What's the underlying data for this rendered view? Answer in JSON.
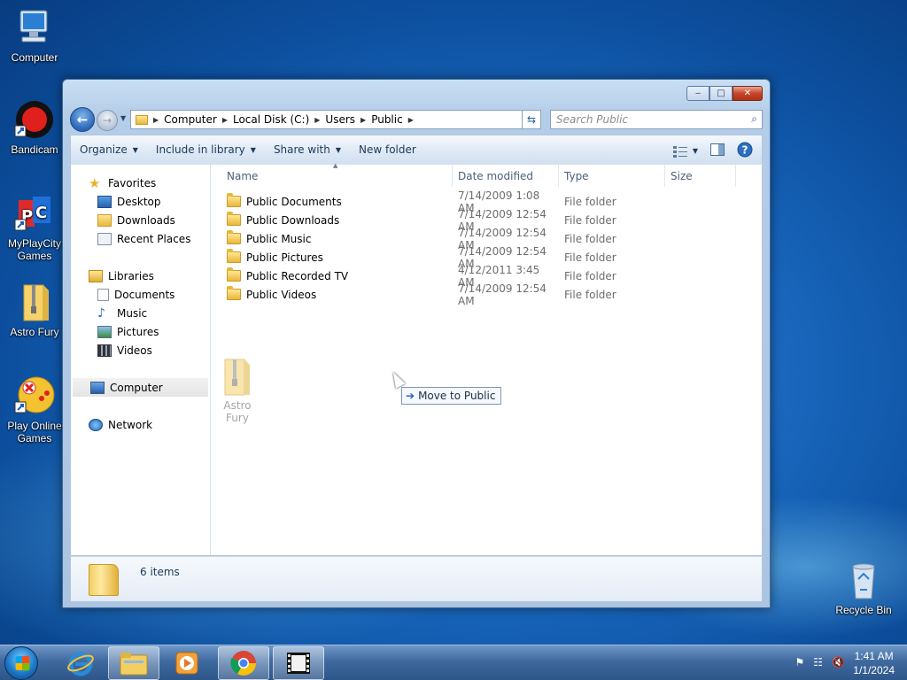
{
  "desktop": {
    "icons": [
      {
        "label": "Computer",
        "icon": "computer-icon"
      },
      {
        "label": "Bandicam",
        "icon": "bandicam-icon"
      },
      {
        "label": "MyPlayCity Games",
        "icon": "myplaycity-icon"
      },
      {
        "label": "Astro Fury",
        "icon": "zip-folder-icon"
      },
      {
        "label": "Play Online Games",
        "icon": "gamepad-icon"
      },
      {
        "label": "Recycle Bin",
        "icon": "recycle-bin-icon"
      }
    ]
  },
  "window": {
    "address": {
      "crumbs": [
        "Computer",
        "Local Disk (C:)",
        "Users",
        "Public"
      ]
    },
    "search_placeholder": "Search Public",
    "commands": {
      "organize": "Organize",
      "include": "Include in library",
      "share": "Share with",
      "new_folder": "New folder"
    },
    "nav": {
      "favorites": "Favorites",
      "desktop": "Desktop",
      "downloads": "Downloads",
      "recent": "Recent Places",
      "libraries": "Libraries",
      "documents": "Documents",
      "music": "Music",
      "pictures": "Pictures",
      "videos": "Videos",
      "computer": "Computer",
      "network": "Network"
    },
    "columns": {
      "name": "Name",
      "date": "Date modified",
      "type": "Type",
      "size": "Size"
    },
    "files": [
      {
        "name": "Public Documents",
        "date": "7/14/2009 1:08 AM",
        "type": "File folder"
      },
      {
        "name": "Public Downloads",
        "date": "7/14/2009 12:54 AM",
        "type": "File folder"
      },
      {
        "name": "Public Music",
        "date": "7/14/2009 12:54 AM",
        "type": "File folder"
      },
      {
        "name": "Public Pictures",
        "date": "7/14/2009 12:54 AM",
        "type": "File folder"
      },
      {
        "name": "Public Recorded TV",
        "date": "4/12/2011 3:45 AM",
        "type": "File folder"
      },
      {
        "name": "Public Videos",
        "date": "7/14/2009 12:54 AM",
        "type": "File folder"
      }
    ],
    "drag": {
      "ghost_label": "Astro Fury",
      "tooltip": "Move to Public"
    },
    "details": {
      "count": "6 items"
    }
  },
  "taskbar": {
    "clock_time": "1:41 AM",
    "clock_date": "1/1/2024"
  },
  "colors": {
    "accent": "#1c6cc4",
    "window_frame": "#aac4e2",
    "close_button": "#c7452a"
  }
}
